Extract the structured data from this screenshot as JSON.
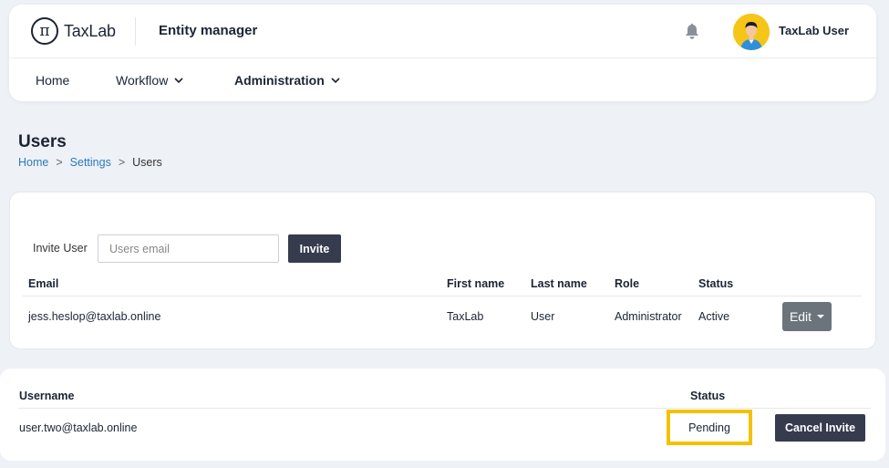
{
  "header": {
    "logo_symbol": "π",
    "logo_text": "TaxLab",
    "app_title": "Entity manager",
    "bell_icon": "bell-icon",
    "user_name": "TaxLab User"
  },
  "nav": {
    "items": [
      {
        "label": "Home"
      },
      {
        "label": "Workflow"
      },
      {
        "label": "Administration"
      }
    ]
  },
  "page": {
    "title": "Users",
    "breadcrumb": [
      "Home",
      "Settings",
      "Users"
    ],
    "breadcrumb_separator": ">"
  },
  "invite": {
    "label": "Invite User",
    "placeholder": "Users email",
    "button_label": "Invite"
  },
  "users_table": {
    "columns": [
      "Email",
      "First name",
      "Last name",
      "Role",
      "Status"
    ],
    "rows": [
      {
        "email": "jess.heslop@taxlab.online",
        "first_name": "TaxLab",
        "last_name": "User",
        "role": "Administrator",
        "status": "Active",
        "action_label": "Edit"
      }
    ]
  },
  "invites_table": {
    "columns": [
      "Username",
      "Status"
    ],
    "rows": [
      {
        "username": "user.two@taxlab.online",
        "status": "Pending",
        "action_label": "Cancel Invite"
      }
    ]
  },
  "colors": {
    "background": "#eef1f6",
    "dark_button": "#363b4e",
    "edit_button": "#6b737b",
    "link": "#2a7bbd",
    "highlight": "#f2c200",
    "avatar_bg": "#f5c518"
  }
}
